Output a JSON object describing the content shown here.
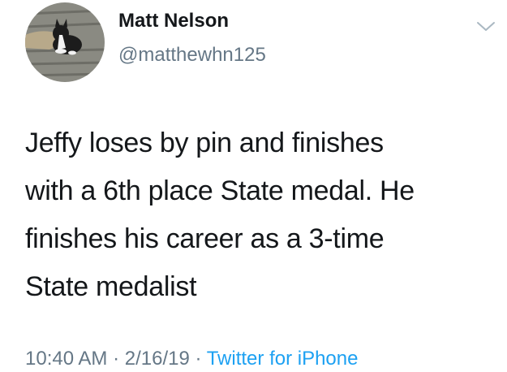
{
  "user": {
    "name": "Matt Nelson",
    "handle": "@matthewhn125"
  },
  "tweet": {
    "lines": [
      "Jeffy loses by pin and finishes",
      "with a 6th place State medal. He",
      "finishes his career as a 3-time",
      "State medalist"
    ],
    "time": "10:40 AM",
    "separator1": " · ",
    "date": "2/16/19",
    "separator2": " · ",
    "source": "Twitter for iPhone"
  },
  "colors": {
    "text": "#14171a",
    "secondary": "#657786",
    "link": "#1da1f2"
  },
  "icons": {
    "avatar": "profile-photo-dog-in-truck-bed",
    "menu": "chevron-down-icon"
  }
}
